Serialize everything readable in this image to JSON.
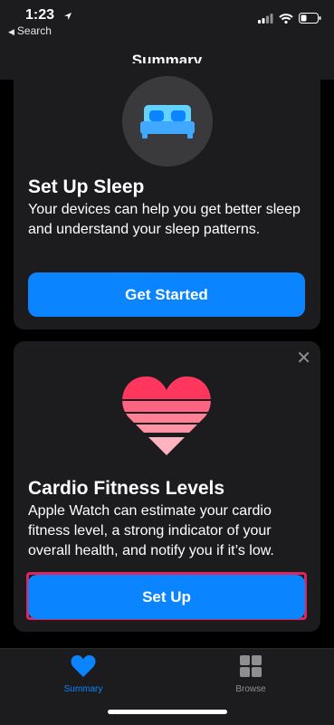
{
  "status": {
    "time": "1:23",
    "back_label": "Search"
  },
  "nav": {
    "title": "Summary"
  },
  "sleep_card": {
    "title": "Set Up Sleep",
    "description": "Your devices can help you get better sleep and understand your sleep patterns.",
    "button_label": "Get Started"
  },
  "cardio_card": {
    "title": "Cardio Fitness Levels",
    "description": "Apple Watch can estimate your cardio fitness level, a strong indicator of your overall health, and notify you if it’s low.",
    "button_label": "Set Up"
  },
  "tabs": [
    {
      "label": "Summary",
      "icon": "heart-icon",
      "active": true
    },
    {
      "label": "Browse",
      "icon": "grid-icon",
      "active": false
    }
  ],
  "colors": {
    "accent": "#0a84ff",
    "highlight": "#e0245e",
    "heart": "#ff375f"
  }
}
